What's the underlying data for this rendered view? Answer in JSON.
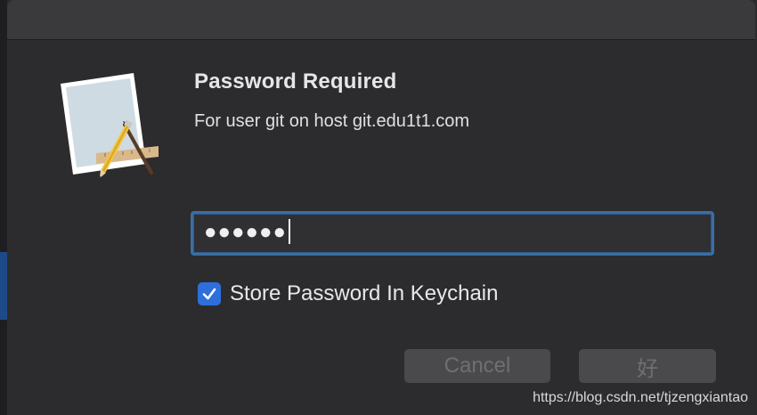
{
  "dialog": {
    "title": "Password Required",
    "subtitle": "For user git on host git.edu1t1.com",
    "password": {
      "masked_value": "●●●●●●"
    },
    "store_password": {
      "checked": true,
      "label": "Store Password In Keychain"
    },
    "buttons": {
      "cancel_label": "Cancel",
      "ok_label": "好"
    },
    "icon": "keychain-app-icon"
  },
  "watermark": "https://blog.csdn.net/tjzengxiantao",
  "colors": {
    "accent": "#2f6fdc",
    "focus_ring": "#3b6ea3",
    "background": "#2c2c2e"
  }
}
